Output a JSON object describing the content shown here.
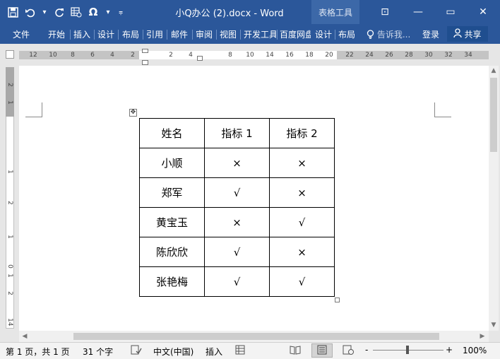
{
  "window": {
    "title": "小Q办公 (2).docx - Word",
    "context_tab_group": "表格工具",
    "minimize_glyph": "—",
    "restore_glyph": "▭",
    "close_glyph": "✕",
    "ribbon_options_glyph": "⊡"
  },
  "quick_access": {
    "save_icon": "save-icon",
    "undo_icon": "undo-icon",
    "redo_icon": "redo-icon",
    "symbol_label": "Ω"
  },
  "ribbon_tabs": [
    {
      "label": "文件"
    },
    {
      "label": "开始"
    },
    {
      "label": "插入"
    },
    {
      "label": "设计"
    },
    {
      "label": "布局"
    },
    {
      "label": "引用"
    },
    {
      "label": "邮件"
    },
    {
      "label": "审阅"
    },
    {
      "label": "视图"
    },
    {
      "label": "开发工具"
    },
    {
      "label": "百度网盘"
    },
    {
      "label": "设计"
    },
    {
      "label": "布局"
    }
  ],
  "tell_me": {
    "placeholder": "告诉我..."
  },
  "account": {
    "login": "登录",
    "share": "共享"
  },
  "ruler": {
    "h_numbers": [
      "12",
      "10",
      "8",
      "6",
      "4",
      "2",
      "2",
      "4",
      "8",
      "10",
      "14",
      "16",
      "18",
      "20",
      "22",
      "24",
      "26",
      "28",
      "30",
      "32",
      "34"
    ],
    "v_numbers": [
      "2",
      "1",
      "1",
      "2",
      "1",
      "0",
      "1",
      "2",
      "14"
    ]
  },
  "table": {
    "headers": [
      "姓名",
      "指标 1",
      "指标 2"
    ],
    "rows": [
      [
        "小顺",
        "×",
        "×"
      ],
      [
        "郑军",
        "√",
        "×"
      ],
      [
        "黄宝玉",
        "×",
        "√"
      ],
      [
        "陈欣欣",
        "√",
        "×"
      ],
      [
        "张艳梅",
        "√",
        "√"
      ]
    ]
  },
  "status": {
    "page": "第 1 页，共 1 页",
    "words": "31 个字",
    "language": "中文(中国)",
    "mode": "插入",
    "zoom": "100%",
    "zoom_minus": "-",
    "zoom_plus": "+"
  }
}
